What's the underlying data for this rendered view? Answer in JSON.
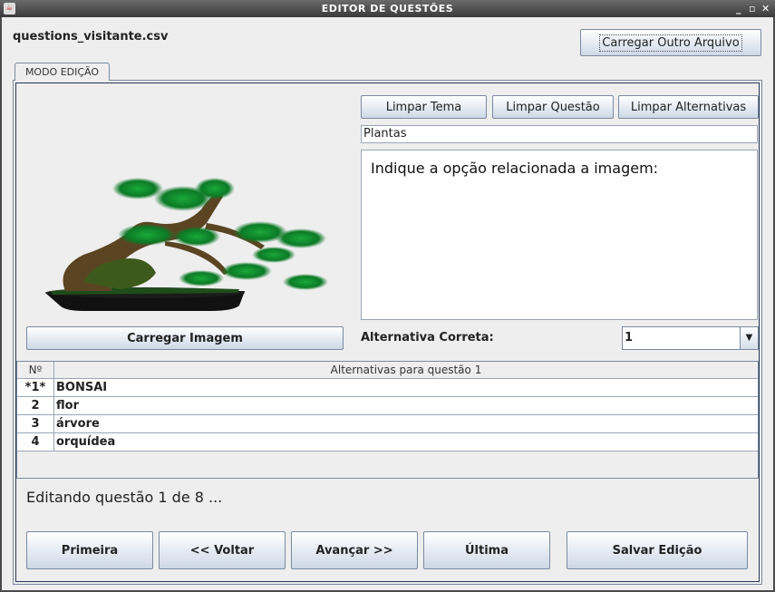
{
  "window": {
    "title": "EDITOR DE QUESTÕES",
    "controls": [
      "_",
      "▫",
      "✕"
    ]
  },
  "file": {
    "name": "questions_visitante.csv",
    "load_other_label": "Carregar Outro Arquivo"
  },
  "tab": {
    "label": "MODO EDIÇÃO"
  },
  "toolbar": {
    "clear_theme": "Limpar Tema",
    "clear_question": "Limpar Questão",
    "clear_alternatives": "Limpar Alternativas"
  },
  "theme": {
    "value": "Plantas"
  },
  "question": {
    "text": "Indique a opção relacionada a imagem:"
  },
  "image": {
    "load_label": "Carregar Imagem",
    "icon": "bonsai-image"
  },
  "correct": {
    "label": "Alternativa Correta:",
    "value": "1"
  },
  "table": {
    "headers": [
      "Nº",
      "Alternativas para questão 1"
    ],
    "rows": [
      {
        "n": "*1*",
        "text": "BONSAI"
      },
      {
        "n": "2",
        "text": "flor"
      },
      {
        "n": "3",
        "text": "árvore"
      },
      {
        "n": "4",
        "text": "orquídea"
      }
    ]
  },
  "status": {
    "text": "Editando questão 1 de 8 ..."
  },
  "nav": {
    "first": "Primeira",
    "back": "<< Voltar",
    "next": "Avançar >>",
    "last": "Última",
    "save": "Salvar Edição"
  }
}
